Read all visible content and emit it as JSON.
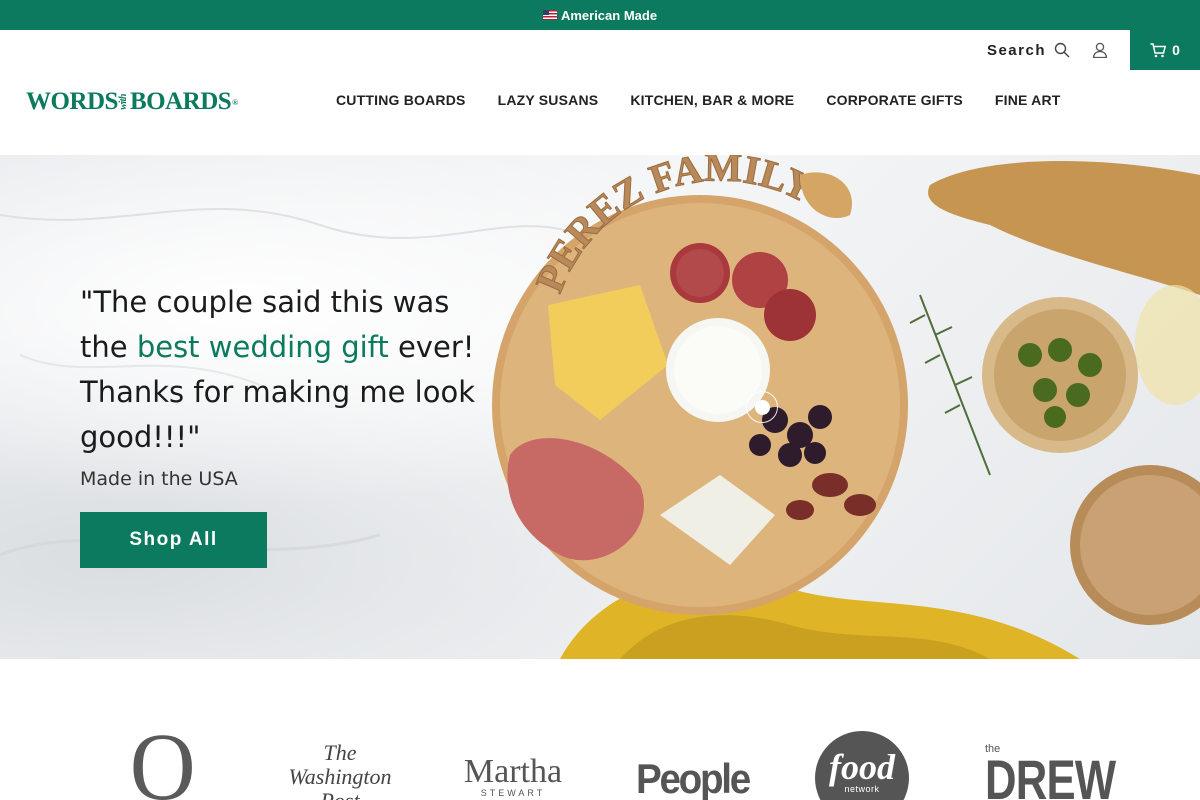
{
  "announcement": {
    "flag_emoji": "🇺🇸",
    "text": "American Made"
  },
  "header": {
    "search_label": "Search",
    "cart_count": "0",
    "logo": {
      "part1": "WORDS",
      "part2": "with",
      "part3": "BOARDS",
      "reg": "®"
    },
    "nav": [
      {
        "label": "CUTTING BOARDS"
      },
      {
        "label": "LAZY SUSANS"
      },
      {
        "label": "KITCHEN, BAR & MORE"
      },
      {
        "label": "CORPORATE GIFTS"
      },
      {
        "label": "FINE ART"
      }
    ]
  },
  "hero": {
    "quote_part1": "\"The couple said this was the ",
    "quote_highlight": "best wedding gift",
    "quote_part2": " ever! Thanks for making me look good!!!\"",
    "subtitle": "Made in the USA",
    "button_label": "Shop All",
    "board_engraving": "PEREZ FAMILY"
  },
  "press": {
    "oprah": "O",
    "washington_post": {
      "line1": "The",
      "line2": "Washington",
      "line3": "Post"
    },
    "martha": {
      "name": "Martha",
      "sub": "STEWART"
    },
    "people": "People",
    "food_network": {
      "big": "food",
      "small": "network"
    },
    "drew": {
      "the": "the",
      "name": "DREW"
    }
  },
  "colors": {
    "brand_green": "#0b7a5e",
    "highlight_text": "#0b7a5e"
  }
}
